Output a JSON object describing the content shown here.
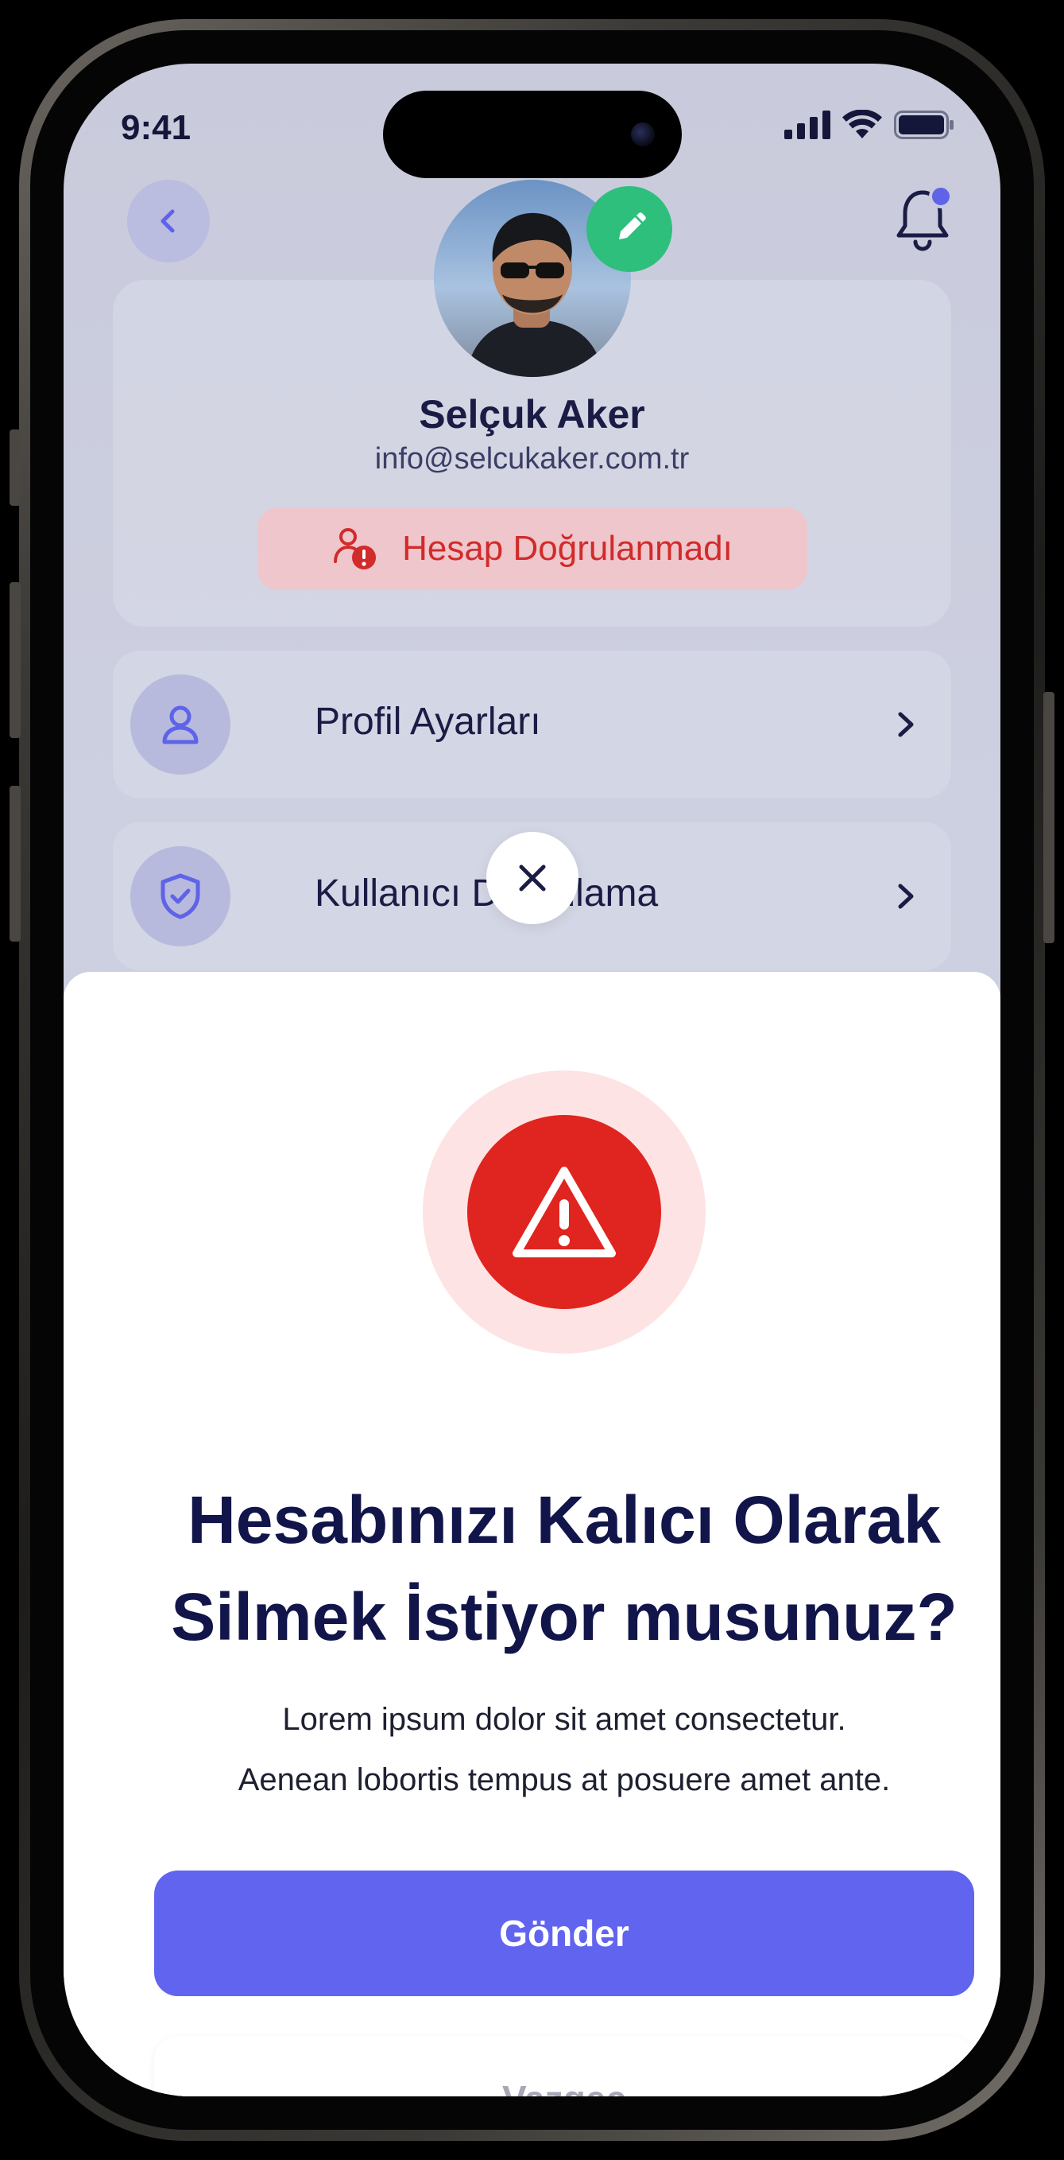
{
  "status_bar": {
    "time": "9:41"
  },
  "profile": {
    "name": "Selçuk Aker",
    "email": "info@selcukaker.com.tr",
    "verification_status": "Hesap Doğrulanmadı"
  },
  "menu": {
    "items": [
      {
        "label": "Profil Ayarları",
        "icon": "user-icon"
      },
      {
        "label": "Kullanıcı Doğrulama",
        "icon": "shield-check-icon"
      }
    ]
  },
  "dialog": {
    "title_line1": "Hesabınızı Kalıcı Olarak",
    "title_line2": "Silmek İstiyor musunuz?",
    "desc_line1": "Lorem ipsum dolor sit amet consectetur.",
    "desc_line2": "Aenean lobortis tempus at posuere amet ante.",
    "primary_label": "Gönder",
    "secondary_label": "Vazgeç",
    "icon": "warning-triangle-icon"
  },
  "colors": {
    "accent": "#6164ee",
    "danger": "#e0241f",
    "success": "#2fbf7c",
    "title": "#12154a"
  }
}
